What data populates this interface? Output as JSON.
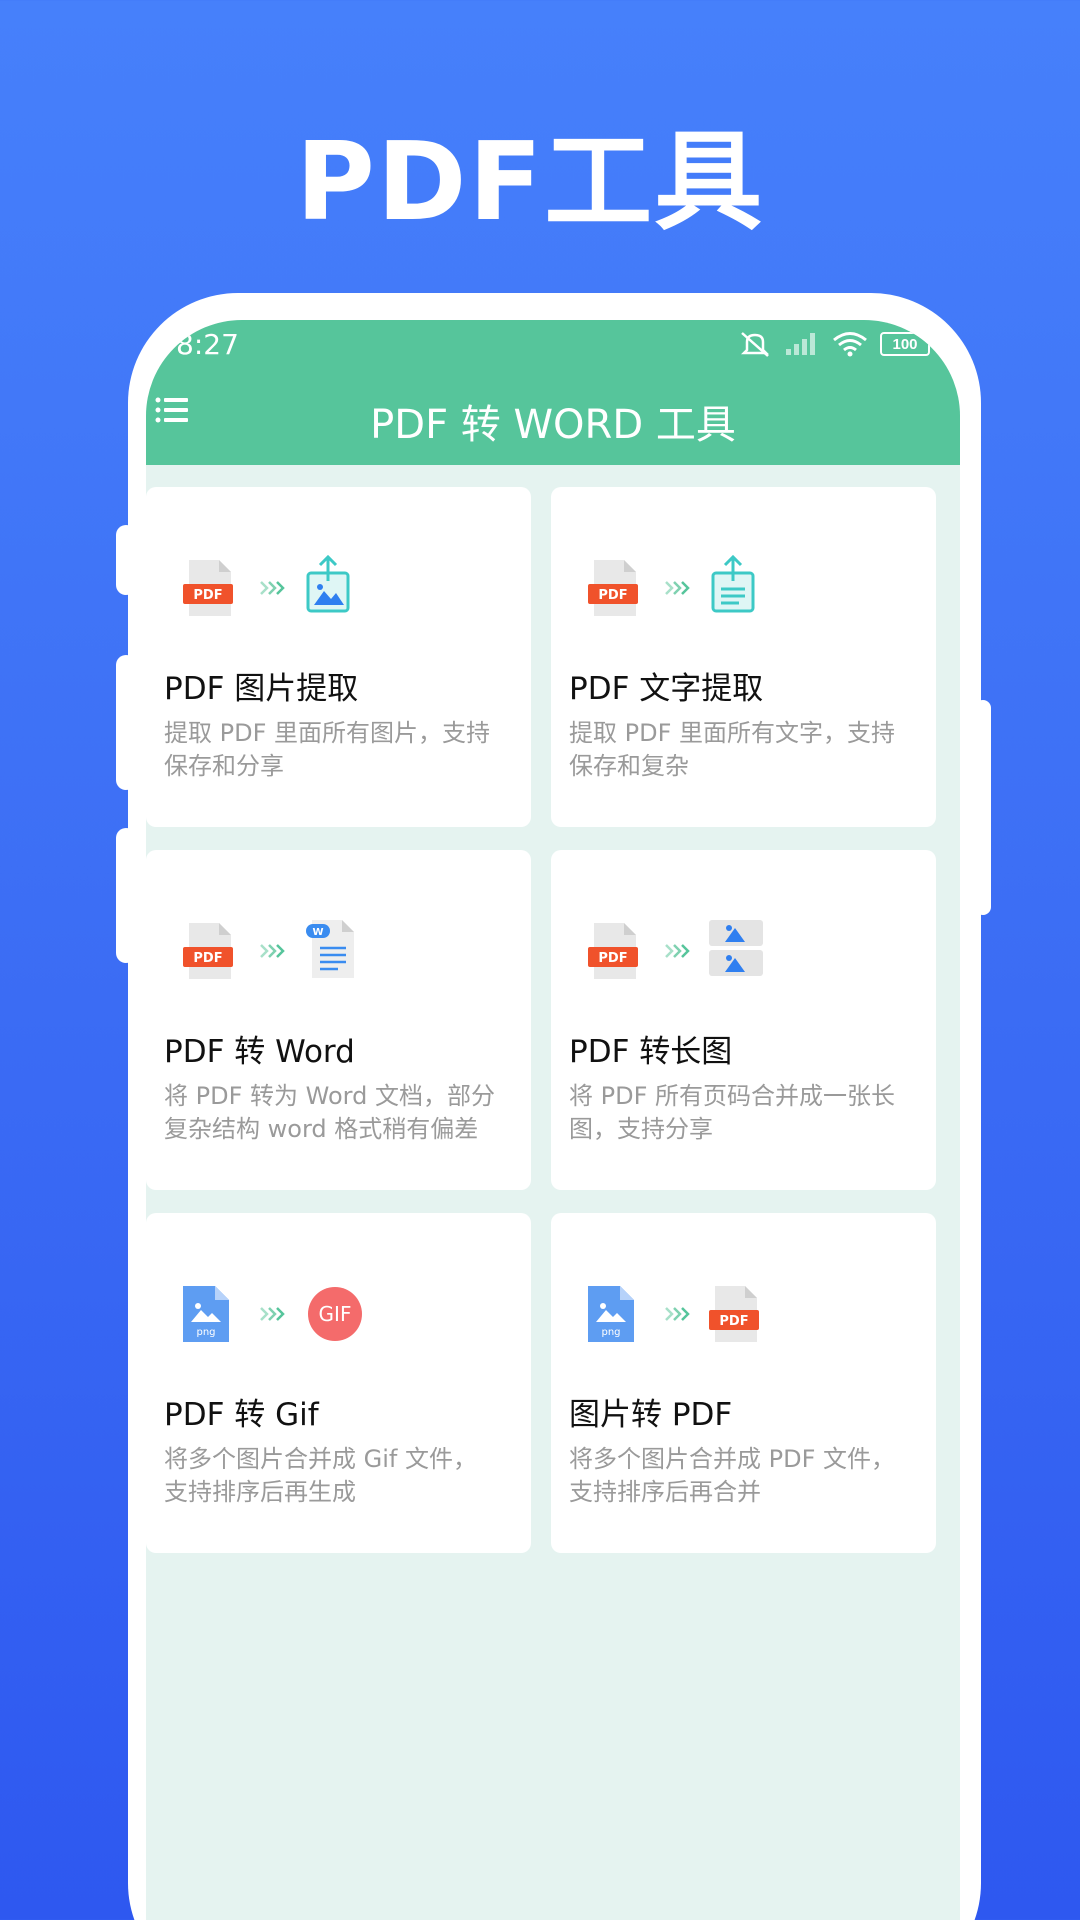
{
  "promo": {
    "title": "PDF工具"
  },
  "status_bar": {
    "time": "8:27",
    "battery": "100"
  },
  "app_bar": {
    "title": "PDF 转 WORD 工具"
  },
  "colors": {
    "accent": "#56c59b",
    "background": "#3d6ff5",
    "pdf_red": "#f0522b"
  },
  "cards": [
    {
      "title": "PDF 图片提取",
      "desc_lines": [
        "提取 PDF 里面所有图片，支持",
        "保存和分享"
      ],
      "from_icon": "pdf-icon",
      "to_icon": "image-export-icon"
    },
    {
      "title": "PDF 文字提取",
      "desc_lines": [
        "提取 PDF 里面所有文字，支持",
        "保存和复杂"
      ],
      "from_icon": "pdf-icon",
      "to_icon": "text-export-icon"
    },
    {
      "title": "PDF 转 Word",
      "desc_lines": [
        "将 PDF 转为 Word 文档，部分",
        "复杂结构 word 格式稍有偏差"
      ],
      "from_icon": "pdf-icon",
      "to_icon": "word-doc-icon"
    },
    {
      "title": "PDF 转长图",
      "desc_lines": [
        "将 PDF 所有页码合并成一张长",
        "图，支持分享"
      ],
      "from_icon": "pdf-icon",
      "to_icon": "long-image-icon"
    },
    {
      "title": "PDF 转 Gif",
      "desc_lines": [
        "将多个图片合并成 Gif 文件，",
        "支持排序后再生成"
      ],
      "from_icon": "png-file-icon",
      "to_icon": "gif-icon",
      "gif_label": "GIF"
    },
    {
      "title": "图片转 PDF",
      "desc_lines": [
        "将多个图片合并成 PDF 文件，",
        "支持排序后再合并"
      ],
      "from_icon": "png-file-icon",
      "to_icon": "pdf-icon"
    }
  ],
  "icon_labels": {
    "pdf": "PDF",
    "png": "png",
    "word": "W"
  }
}
